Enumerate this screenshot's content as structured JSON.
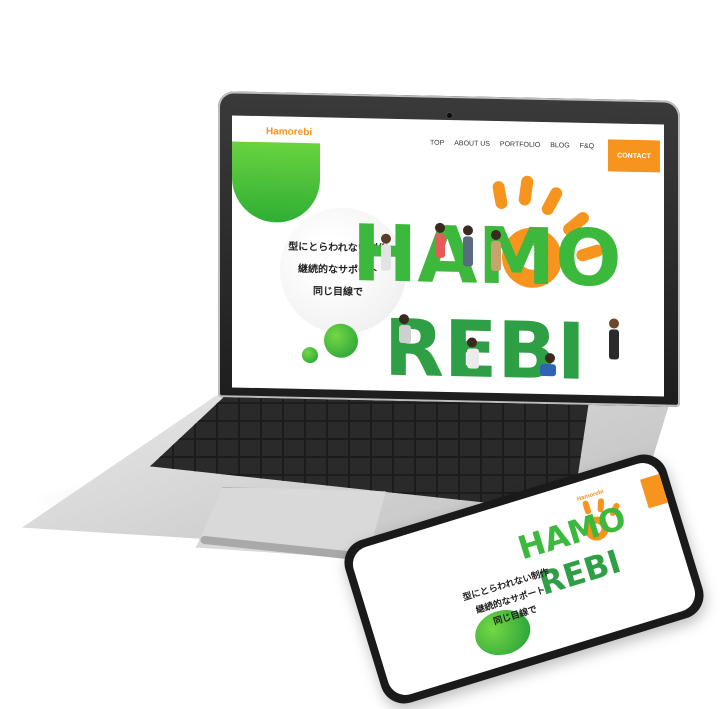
{
  "site": {
    "brand": "Hamorebi",
    "nav": [
      "TOP",
      "ABOUT US",
      "PORTFOLIO",
      "BLOG",
      "F&Q"
    ],
    "contact": "CONTACT",
    "hero_lines": [
      "型にとらわれない制作",
      "継続的なサポート",
      "同じ目線で"
    ],
    "logo_line1": "HAMO",
    "logo_line2": "REBI"
  },
  "phone": {
    "brand": "Hamorebi",
    "hero_lines": [
      "型にとらわれない制作",
      "継続的なサポート",
      "同じ目線で"
    ],
    "logo_line1": "HAMO",
    "logo_line2": "REBI"
  },
  "colors": {
    "brand_orange": "#f7941d",
    "brand_green": "#3cb93c",
    "dark_frame": "#1a1a1a"
  }
}
